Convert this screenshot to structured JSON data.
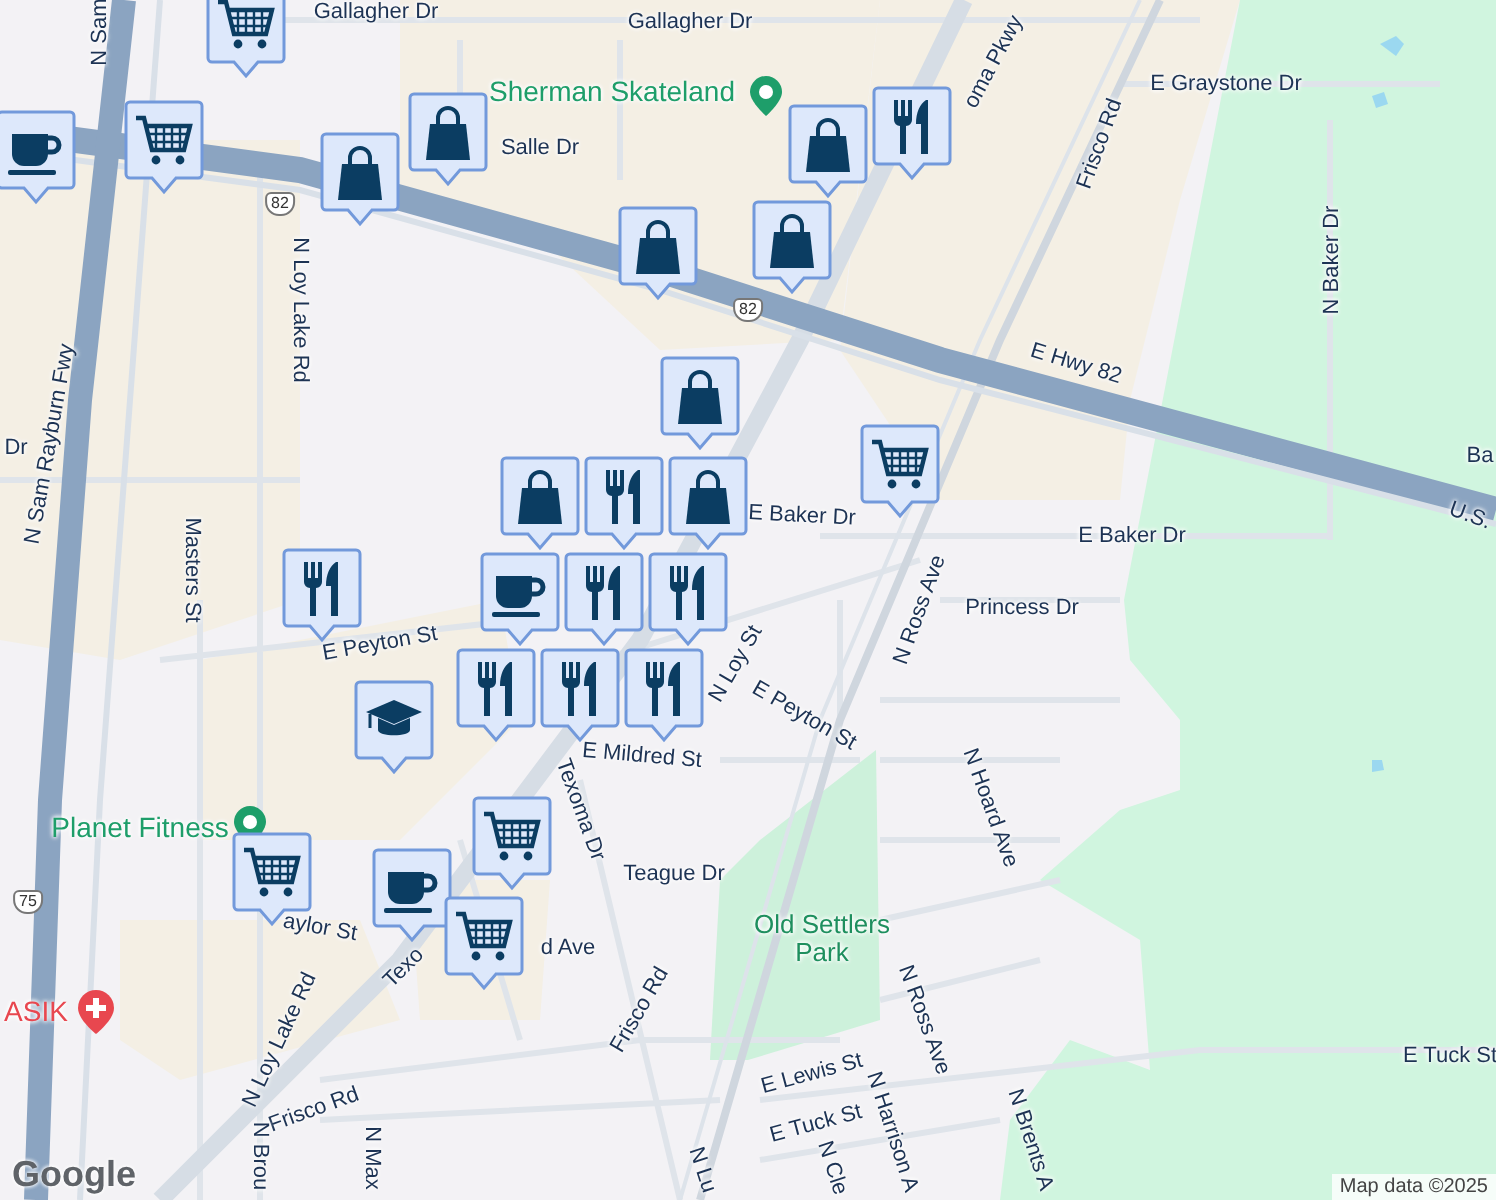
{
  "labels": [
    {
      "text": "Gallagher Dr",
      "kind": "street"
    },
    {
      "text": "Gallagher Dr",
      "kind": "street"
    },
    {
      "text": "N Sam",
      "kind": "street"
    },
    {
      "text": "Sherman Skateland",
      "kind": "poi"
    },
    {
      "text": "Salle Dr",
      "kind": "street"
    },
    {
      "text": "N Loy Lake Rd",
      "kind": "street"
    },
    {
      "text": "N Sam Rayburn Fwy",
      "kind": "street"
    },
    {
      "text": "Dr",
      "kind": "street"
    },
    {
      "text": "Masters St",
      "kind": "street"
    },
    {
      "text": "oma Pkwy",
      "kind": "street"
    },
    {
      "text": "E Graystone Dr",
      "kind": "street"
    },
    {
      "text": "Frisco Rd",
      "kind": "street"
    },
    {
      "text": "N Baker Dr",
      "kind": "street"
    },
    {
      "text": "E Hwy 82",
      "kind": "street"
    },
    {
      "text": "Ba",
      "kind": "street"
    },
    {
      "text": "U.S.",
      "kind": "street"
    },
    {
      "text": "E Baker Dr",
      "kind": "street"
    },
    {
      "text": "E Baker Dr",
      "kind": "street"
    },
    {
      "text": "Princess Dr",
      "kind": "street"
    },
    {
      "text": "N Ross Ave",
      "kind": "street"
    },
    {
      "text": "E Peyton St",
      "kind": "street"
    },
    {
      "text": "N Loy St",
      "kind": "street"
    },
    {
      "text": "E Peyton St",
      "kind": "street"
    },
    {
      "text": "E Mildred St",
      "kind": "street"
    },
    {
      "text": "Texoma Dr",
      "kind": "street"
    },
    {
      "text": "Teague Dr",
      "kind": "street"
    },
    {
      "text": "Planet Fitness",
      "kind": "poi"
    },
    {
      "text": "aylor St",
      "kind": "street"
    },
    {
      "text": "Texo",
      "kind": "street"
    },
    {
      "text": "d Ave",
      "kind": "street"
    },
    {
      "text": "ASIK",
      "kind": "hospital"
    },
    {
      "text": "N Loy Lake Rd",
      "kind": "street"
    },
    {
      "text": "Frisco Rd",
      "kind": "street"
    },
    {
      "text": "Frisco Rd",
      "kind": "street"
    },
    {
      "text": "Old Settlers Park",
      "kind": "park"
    },
    {
      "text": "N Hoard Ave",
      "kind": "street"
    },
    {
      "text": "N Ross Ave",
      "kind": "street"
    },
    {
      "text": "E Tuck St",
      "kind": "street"
    },
    {
      "text": "E Lewis St",
      "kind": "street"
    },
    {
      "text": "E Tuck St",
      "kind": "street"
    },
    {
      "text": "N Harrison A",
      "kind": "street"
    },
    {
      "text": "N Cle",
      "kind": "street"
    },
    {
      "text": "N Brents A",
      "kind": "street"
    },
    {
      "text": "N Lu",
      "kind": "street"
    },
    {
      "text": "N Brou",
      "kind": "street"
    },
    {
      "text": "N Max",
      "kind": "street"
    }
  ],
  "shields": [
    "82",
    "82",
    "75"
  ],
  "markers": [
    {
      "kind": "cart"
    },
    {
      "kind": "cup"
    },
    {
      "kind": "cart"
    },
    {
      "kind": "bag"
    },
    {
      "kind": "bag"
    },
    {
      "kind": "food"
    },
    {
      "kind": "bag"
    },
    {
      "kind": "bag"
    },
    {
      "kind": "bag"
    },
    {
      "kind": "bag"
    },
    {
      "kind": "cart"
    },
    {
      "kind": "food"
    },
    {
      "kind": "bag"
    },
    {
      "kind": "food"
    },
    {
      "kind": "bag"
    },
    {
      "kind": "cup"
    },
    {
      "kind": "food"
    },
    {
      "kind": "food"
    },
    {
      "kind": "food"
    },
    {
      "kind": "food"
    },
    {
      "kind": "food"
    },
    {
      "kind": "school"
    },
    {
      "kind": "cart"
    },
    {
      "kind": "cart"
    },
    {
      "kind": "cup"
    },
    {
      "kind": "cart"
    }
  ],
  "logo": "Google",
  "attribution": "Map data ©2025"
}
